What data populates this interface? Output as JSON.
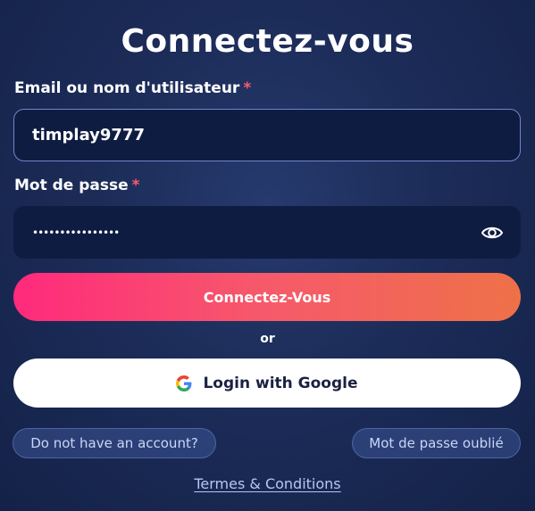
{
  "title": "Connectez-vous",
  "email": {
    "label": "Email ou nom d'utilisateur",
    "required_mark": "*",
    "value": "timplay9777"
  },
  "password": {
    "label": "Mot de passe",
    "required_mark": "*",
    "masked_value": "••••••••••••••••",
    "visibility_icon": "eye-icon"
  },
  "submit_label": "Connectez-Vous",
  "separator": "or",
  "google": {
    "label": "Login with Google",
    "icon": "google-icon"
  },
  "links": {
    "signup": "Do not have an account?",
    "forgot_password": "Mot de passe oublié",
    "terms": "Termes & Conditions"
  },
  "colors": {
    "background": "#1c2c58",
    "input_bg": "#0f1c42",
    "required": "#ff5a6a",
    "gradient_start": "#ff2a7c",
    "gradient_end": "#ee7148"
  }
}
